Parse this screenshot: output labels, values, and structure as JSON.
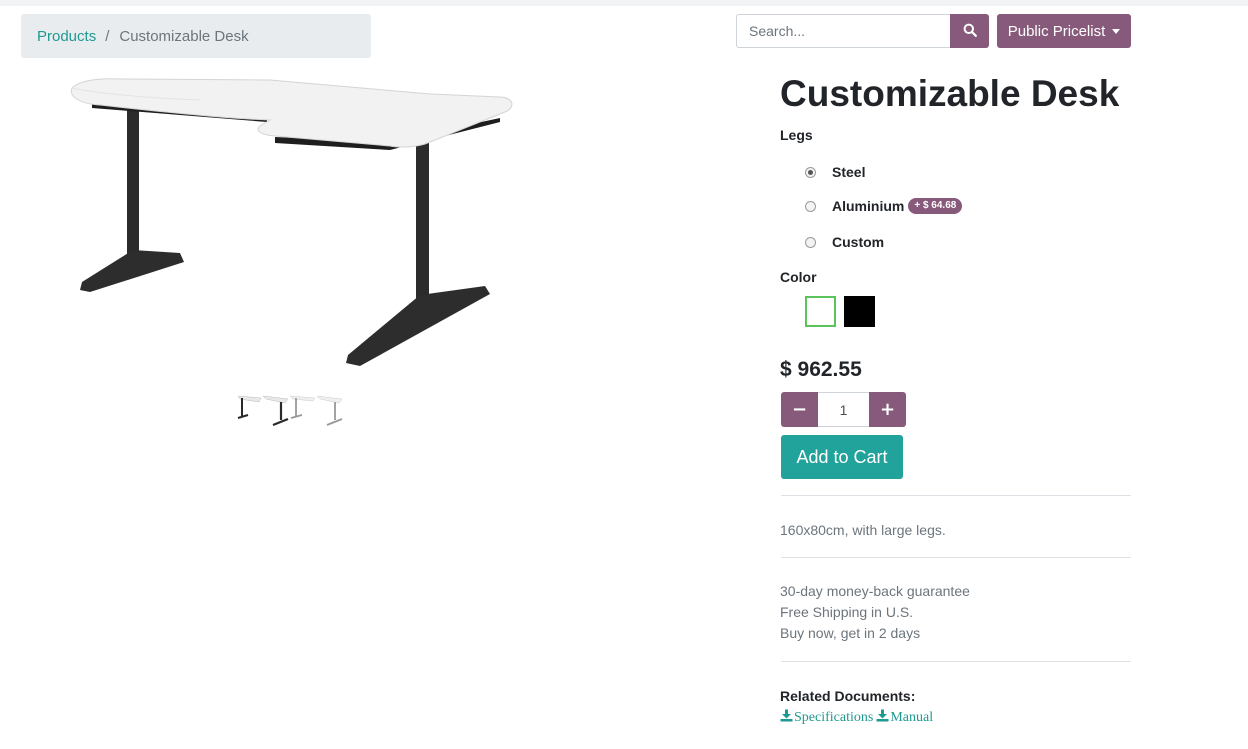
{
  "breadcrumb": {
    "parent": "Products",
    "separator": "/",
    "current": "Customizable Desk"
  },
  "search": {
    "placeholder": "Search...",
    "icon": "search-icon"
  },
  "pricelist": {
    "label": "Public Pricelist"
  },
  "product": {
    "title": "Customizable Desk",
    "attributes": {
      "legs": {
        "label": "Legs",
        "options": [
          {
            "label": "Steel",
            "checked": true,
            "extra": ""
          },
          {
            "label": "Aluminium",
            "checked": false,
            "extra": "+ $ 64.68"
          },
          {
            "label": "Custom",
            "checked": false,
            "extra": ""
          }
        ]
      },
      "color": {
        "label": "Color",
        "swatches": [
          {
            "name": "white",
            "hex": "#ffffff",
            "selected": true
          },
          {
            "name": "black",
            "hex": "#000000",
            "selected": false
          }
        ]
      }
    },
    "price": "$ 962.55",
    "quantity": "1",
    "minus_label": "−",
    "plus_label": "+",
    "add_to_cart": "Add to Cart",
    "description": "160x80cm, with large legs.",
    "guarantee": [
      "30-day money-back guarantee",
      "Free Shipping in U.S.",
      "Buy now, get in 2 days"
    ],
    "related": {
      "title": "Related Documents:",
      "documents": [
        "Specifications",
        "Manual"
      ]
    }
  },
  "colors": {
    "primary": "#875a7b",
    "accent": "#21a29a",
    "link": "#1f9a90",
    "selected_swatch_border": "#5bc35b"
  }
}
